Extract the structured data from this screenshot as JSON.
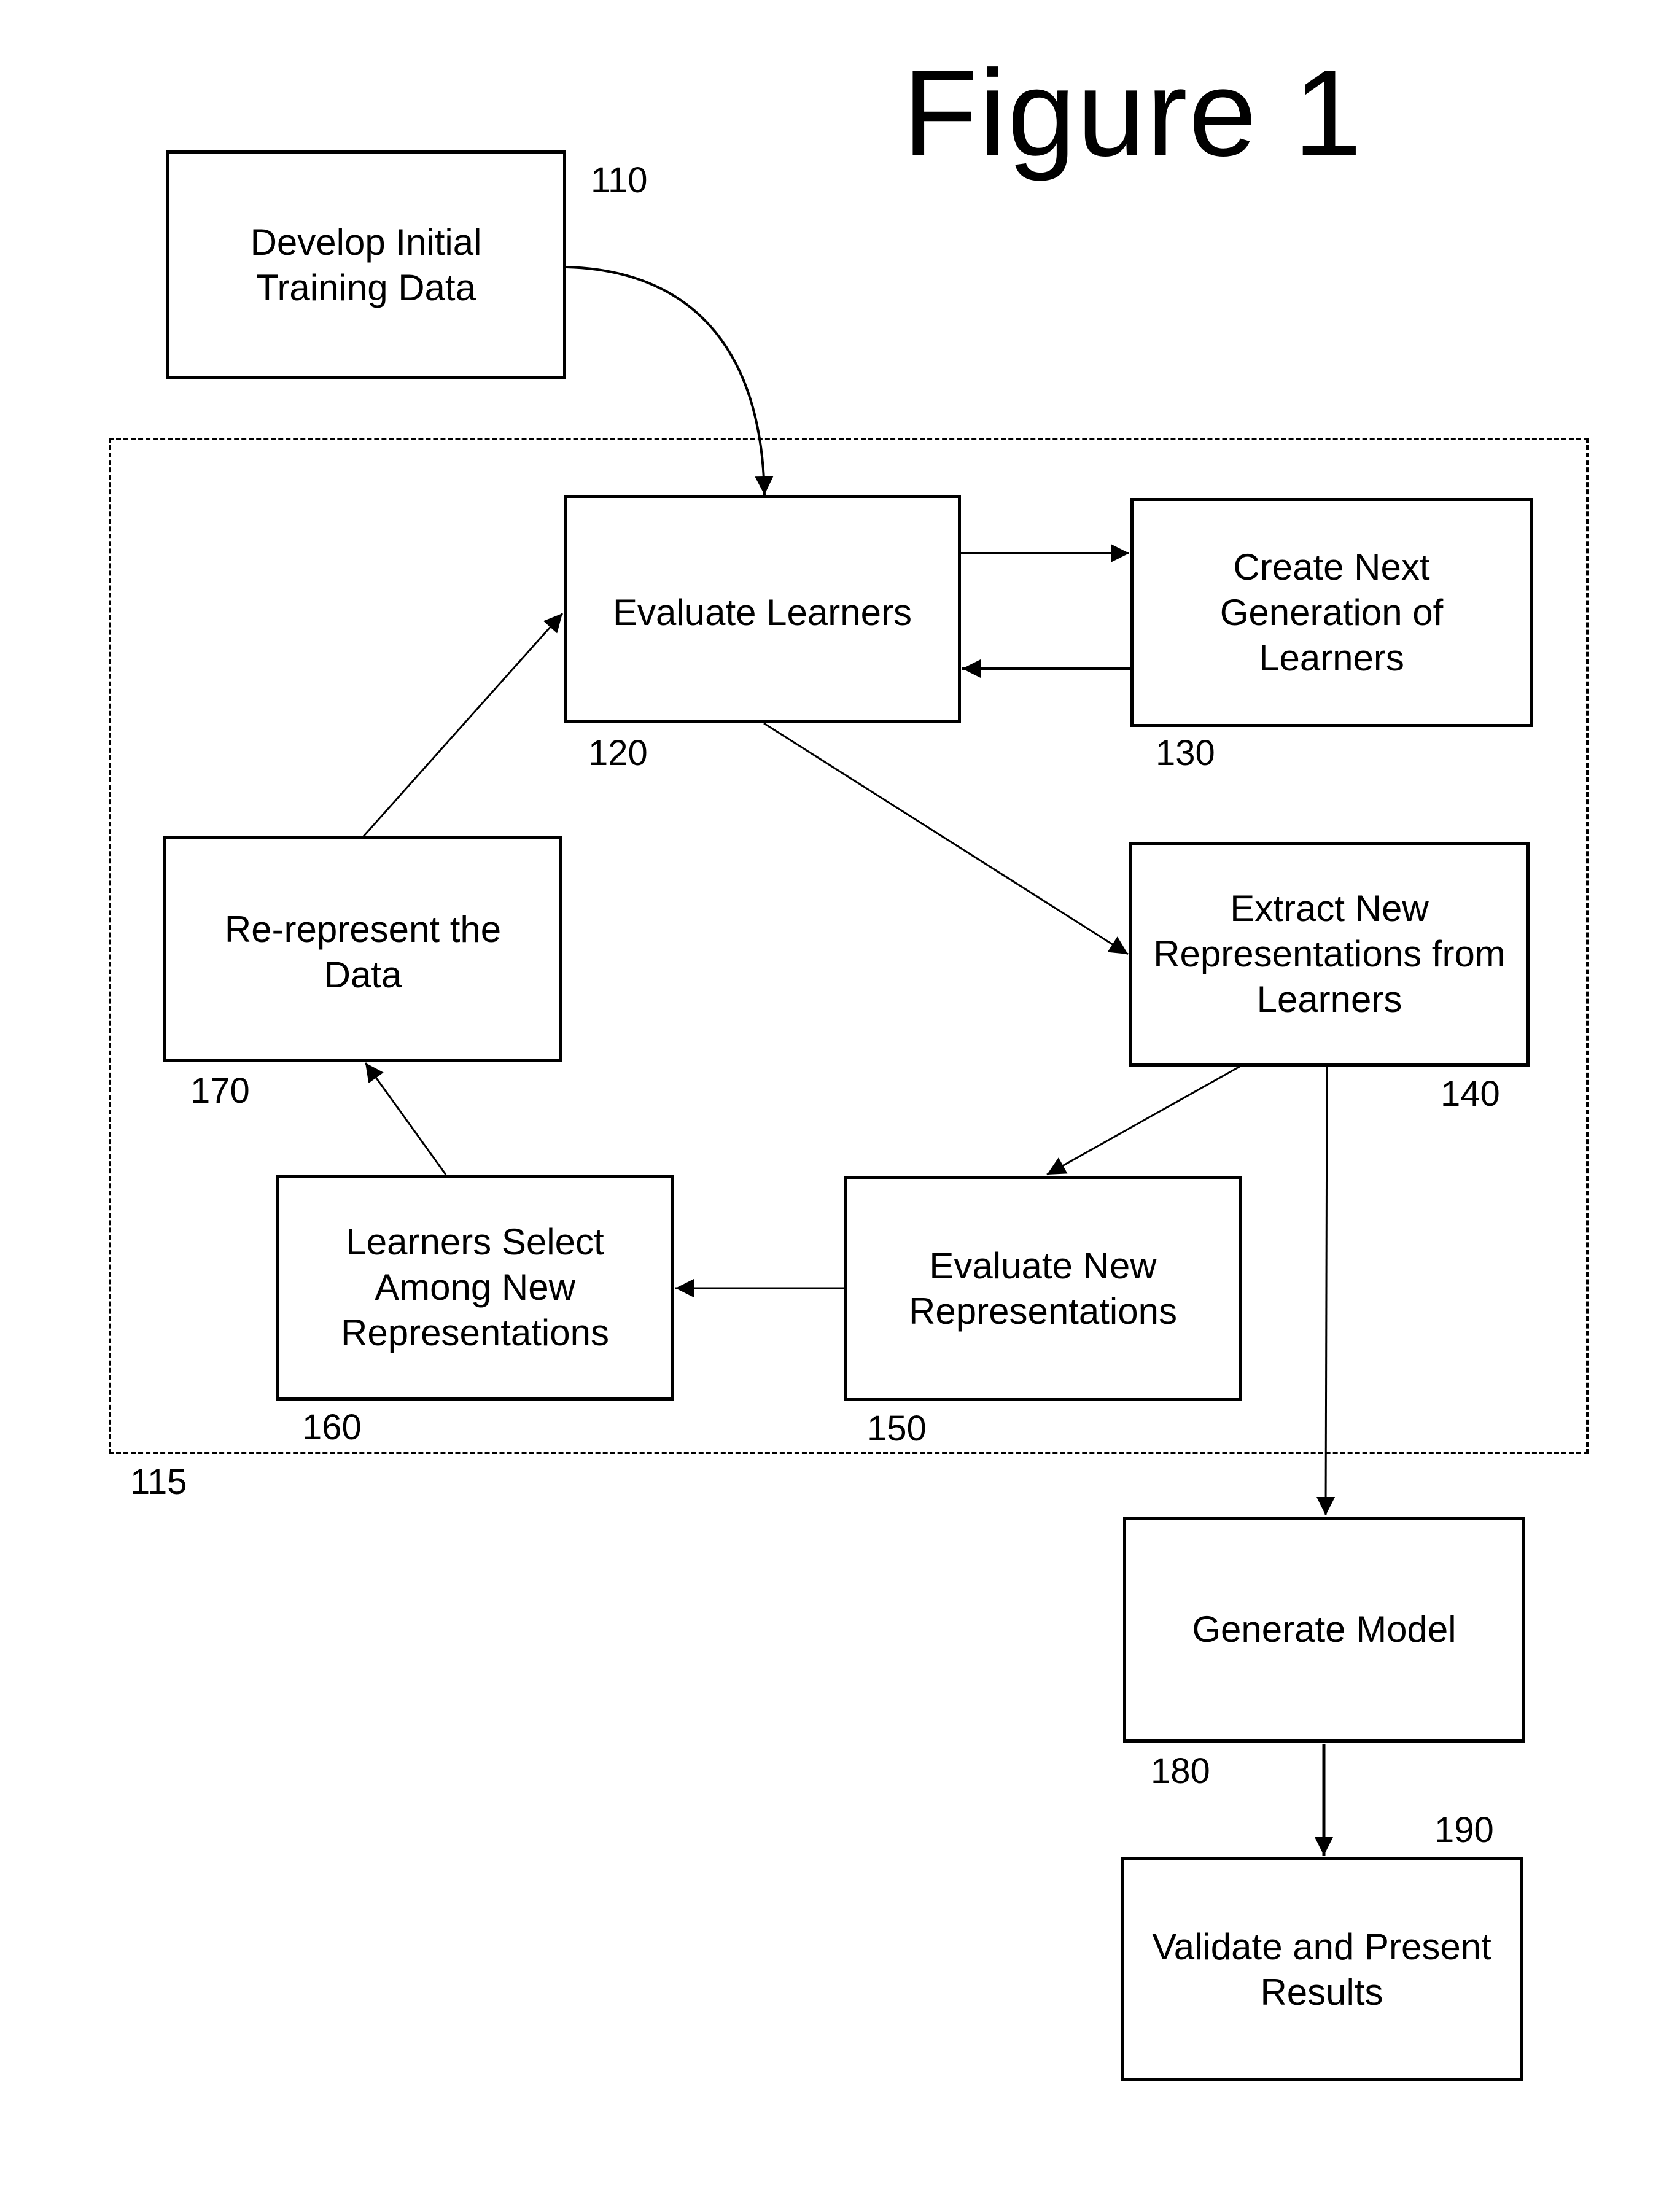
{
  "figure": {
    "title": "Figure 1"
  },
  "group": {
    "ref": "115"
  },
  "steps": {
    "s110": {
      "ref": "110",
      "label": "Develop Initial\nTraining Data"
    },
    "s120": {
      "ref": "120",
      "label": "Evaluate Learners"
    },
    "s130": {
      "ref": "130",
      "label": "Create Next\nGeneration of\nLearners"
    },
    "s140": {
      "ref": "140",
      "label": "Extract New\nRepresentations from\nLearners"
    },
    "s150": {
      "ref": "150",
      "label": "Evaluate New\nRepresentations"
    },
    "s160": {
      "ref": "160",
      "label": "Learners Select\nAmong New\nRepresentations"
    },
    "s170": {
      "ref": "170",
      "label": "Re-represent the\nData"
    },
    "s180": {
      "ref": "180",
      "label": "Generate Model"
    },
    "s190": {
      "ref": "190",
      "label": "Validate and Present\nResults"
    }
  },
  "edges": [
    {
      "from": "110",
      "to": "120"
    },
    {
      "from": "120",
      "to": "130"
    },
    {
      "from": "130",
      "to": "120"
    },
    {
      "from": "120",
      "to": "140"
    },
    {
      "from": "140",
      "to": "150"
    },
    {
      "from": "150",
      "to": "160"
    },
    {
      "from": "160",
      "to": "170"
    },
    {
      "from": "170",
      "to": "120"
    },
    {
      "from": "140",
      "to": "180"
    },
    {
      "from": "180",
      "to": "190"
    }
  ]
}
